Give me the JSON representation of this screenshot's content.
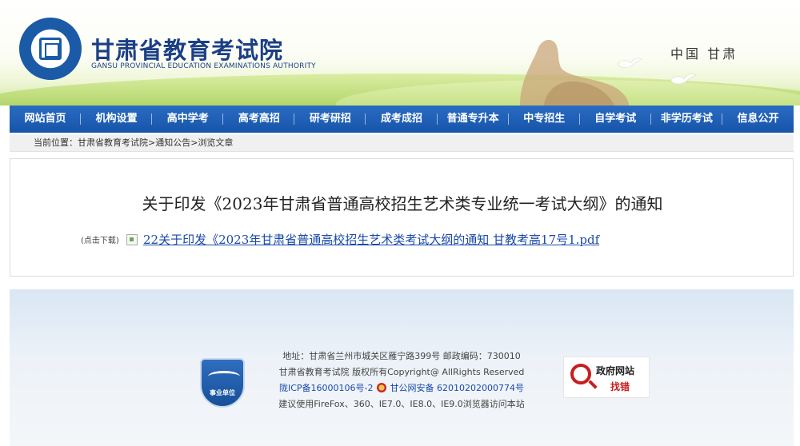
{
  "header": {
    "site_name": "甘肃省教育考试院",
    "site_name_en": "GANSU PROVINCIAL EDUCATION EXAMINATIONS AUTHORITY",
    "region": "中国 甘肃"
  },
  "nav": {
    "items": [
      "网站首页",
      "机构设置",
      "高中学考",
      "高考高招",
      "研考研招",
      "成考成招",
      "普通专升本",
      "中专招生",
      "自学考试",
      "非学历考试",
      "信息公开"
    ]
  },
  "breadcrumb": {
    "text": "当前位置：甘肃省教育考试院>通知公告>浏览文章"
  },
  "article": {
    "title": "关于印发《2023年甘肃省普通高校招生艺术类专业统一考试大纲》的通知",
    "download_hint": "(点击下载)",
    "attachment": "22关于印发《2023年甘肃省普通高校招生艺术类考试大纲的通知 甘教考高17号1.pdf"
  },
  "footer": {
    "badge_label": "事业单位",
    "address": "地址：甘肃省兰州市城关区雁宁路399号 邮政编码：730010",
    "copyright": "甘肃省教育考试院  版权所有Copyright@ AllRights Reserved",
    "icp": "陇ICP备16000106号-2",
    "police": "甘公网安备 62010202000774号",
    "browser": "建议使用FireFox、360、IE7.0、IE8.0、IE9.0浏览器访问本站",
    "gov_error_line1": "政府网站",
    "gov_error_line2": "找错"
  },
  "colors": {
    "nav_blue": "#1654a9",
    "link_blue": "#1a4aa8",
    "brand_blue": "#1b3f86",
    "error_red": "#c81e1e"
  }
}
